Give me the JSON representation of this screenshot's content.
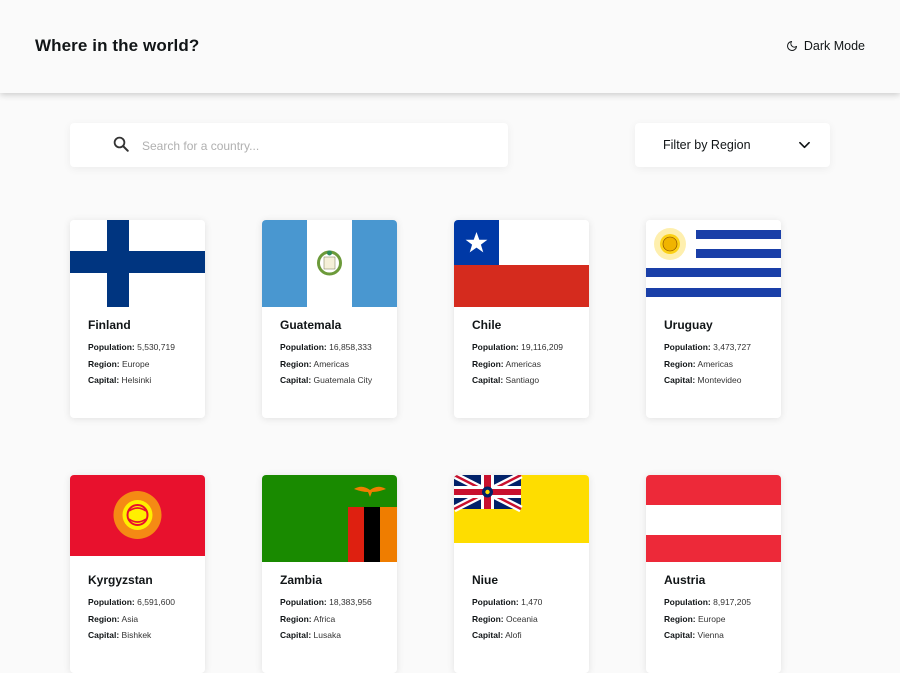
{
  "header": {
    "title": "Where in the world?",
    "theme_toggle_label": "Dark Mode",
    "theme_icon": "moon-icon"
  },
  "search": {
    "placeholder": "Search for a country...",
    "value": "",
    "icon": "search-icon"
  },
  "filter": {
    "label": "Filter by Region",
    "icon": "chevron-down-icon"
  },
  "field_labels": {
    "population": "Population:",
    "region": "Region:",
    "capital": "Capital:"
  },
  "countries": [
    {
      "name": "Finland",
      "population": "5,530,719",
      "region": "Europe",
      "capital": "Helsinki"
    },
    {
      "name": "Guatemala",
      "population": "16,858,333",
      "region": "Americas",
      "capital": "Guatemala City"
    },
    {
      "name": "Chile",
      "population": "19,116,209",
      "region": "Americas",
      "capital": "Santiago"
    },
    {
      "name": "Uruguay",
      "population": "3,473,727",
      "region": "Americas",
      "capital": "Montevideo"
    },
    {
      "name": "Kyrgyzstan",
      "population": "6,591,600",
      "region": "Asia",
      "capital": "Bishkek"
    },
    {
      "name": "Zambia",
      "population": "18,383,956",
      "region": "Africa",
      "capital": "Lusaka"
    },
    {
      "name": "Niue",
      "population": "1,470",
      "region": "Oceania",
      "capital": "Alofi"
    },
    {
      "name": "Austria",
      "population": "8,917,205",
      "region": "Europe",
      "capital": "Vienna"
    }
  ],
  "colors": {
    "background": "#fafafa",
    "card": "#ffffff",
    "text": "#111517"
  }
}
